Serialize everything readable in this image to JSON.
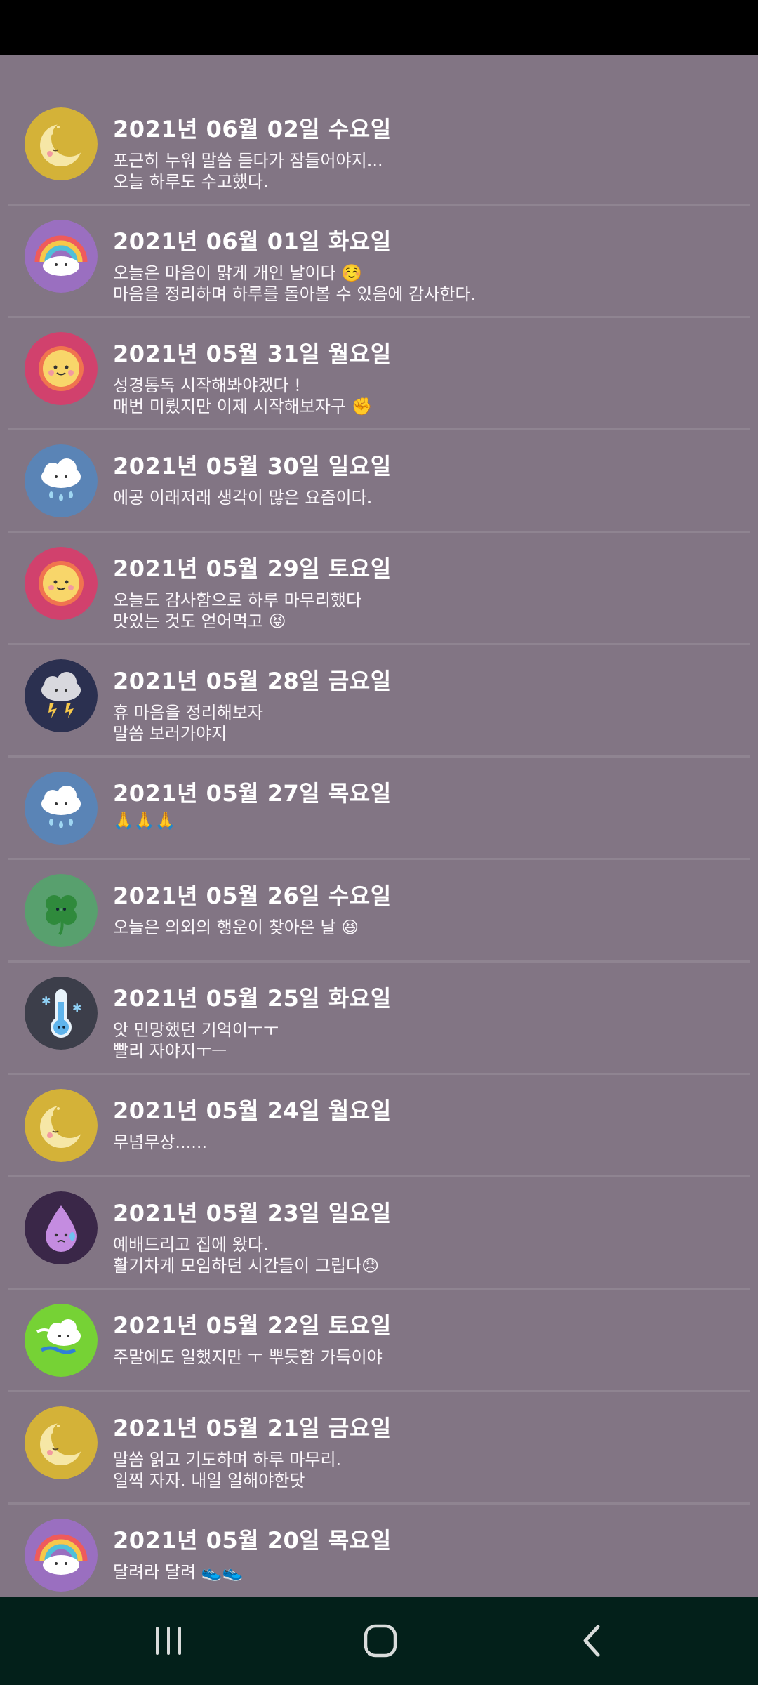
{
  "entries": [
    {
      "date": "2021년 06월 02일 수요일",
      "lines": [
        "포근히 누워 말씀 듣다가 잠들어야지...",
        "오늘 하루도 수고했다."
      ],
      "mood_icon": "moon-icon",
      "icon_bg": "#d4b238"
    },
    {
      "date": "2021년 06월 01일 화요일",
      "lines": [
        "오늘은 마음이 맑게 개인 날이다 ☺️",
        "마음을 정리하며 하루를 돌아볼 수 있음에 감사한다."
      ],
      "mood_icon": "rainbow-icon",
      "icon_bg": "#9a6fc0"
    },
    {
      "date": "2021년 05월 31일 월요일",
      "lines": [
        "성경통독 시작해봐야겠다 !",
        "매번 미뤘지만 이제 시작해보자구 ✊"
      ],
      "mood_icon": "sun-icon",
      "icon_bg": "#d1416d"
    },
    {
      "date": "2021년 05월 30일 일요일",
      "lines": [
        "에공 이래저래 생각이 많은 요즘이다."
      ],
      "mood_icon": "rain-cloud-icon",
      "icon_bg": "#5a84b6"
    },
    {
      "date": "2021년 05월 29일 토요일",
      "lines": [
        "오늘도 감사함으로 하루 마무리했다",
        "맛있는 것도 얻어먹고 😝"
      ],
      "mood_icon": "sun-icon",
      "icon_bg": "#d1416d"
    },
    {
      "date": "2021년 05월 28일 금요일",
      "lines": [
        "휴 마음을 정리해보자",
        "말씀 보러가야지"
      ],
      "mood_icon": "storm-cloud-icon",
      "icon_bg": "#2b3050"
    },
    {
      "date": "2021년 05월 27일 목요일",
      "lines": [
        "🙏🙏🙏"
      ],
      "mood_icon": "rain-cloud-icon",
      "icon_bg": "#5a84b6"
    },
    {
      "date": "2021년 05월 26일 수요일",
      "lines": [
        "오늘은 의외의 행운이 찾아온 날 😆"
      ],
      "mood_icon": "clover-icon",
      "icon_bg": "#58a06e"
    },
    {
      "date": "2021년 05월 25일 화요일",
      "lines": [
        "앗 민망했던 기억이ㅜㅜ",
        "빨리 자야지ㅜㅡ"
      ],
      "mood_icon": "thermometer-icon",
      "icon_bg": "#3c3e4a"
    },
    {
      "date": "2021년 05월 24일 월요일",
      "lines": [
        "무념무상......"
      ],
      "mood_icon": "moon-icon",
      "icon_bg": "#d4b238"
    },
    {
      "date": "2021년 05월 23일 일요일",
      "lines": [
        "예배드리고 집에 왔다.",
        "활기차게 모임하던 시간들이 그립다😞"
      ],
      "mood_icon": "drop-icon",
      "icon_bg": "#3a2748"
    },
    {
      "date": "2021년 05월 22일 토요일",
      "lines": [
        "주말에도 일했지만 ㅜ 뿌듯함 가득이야"
      ],
      "mood_icon": "wind-cloud-icon",
      "icon_bg": "#76d235"
    },
    {
      "date": "2021년 05월 21일 금요일",
      "lines": [
        "말씀 읽고 기도하며 하루 마무리.",
        "일찍 자자. 내일 일해야한닷"
      ],
      "mood_icon": "moon-icon",
      "icon_bg": "#d4b238"
    },
    {
      "date": "2021년 05월 20일 목요일",
      "lines": [
        "달려라 달려 👟👟"
      ],
      "mood_icon": "rainbow-icon",
      "icon_bg": "#9a6fc0"
    }
  ],
  "nav": {
    "recents_icon": "recents-icon",
    "home_icon": "home-icon",
    "back_icon": "back-icon"
  }
}
